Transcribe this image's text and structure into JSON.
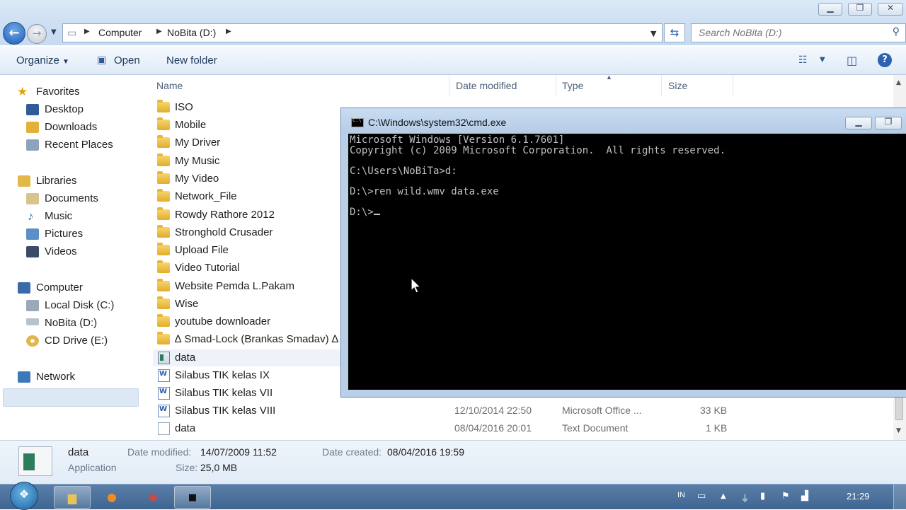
{
  "explorer": {
    "breadcrumb": [
      "Computer",
      "NoBita (D:)"
    ],
    "search_placeholder": "Search NoBita (D:)",
    "toolbar": {
      "organize": "Organize",
      "open": "Open",
      "new_folder": "New folder"
    }
  },
  "nav": {
    "favorites": "Favorites",
    "desktop": "Desktop",
    "downloads": "Downloads",
    "recent_places": "Recent Places",
    "libraries": "Libraries",
    "documents": "Documents",
    "music": "Music",
    "pictures": "Pictures",
    "videos": "Videos",
    "computer": "Computer",
    "local_disk": "Local Disk (C:)",
    "nobita": "NoBita (D:)",
    "cd_drive": "CD Drive (E:)",
    "network": "Network"
  },
  "columns": {
    "name": "Name",
    "date_modified": "Date modified",
    "type": "Type",
    "size": "Size"
  },
  "files": [
    {
      "name": "ISO",
      "kind": "folder"
    },
    {
      "name": "Mobile",
      "kind": "folder"
    },
    {
      "name": "My Driver",
      "kind": "folder"
    },
    {
      "name": "My Music",
      "kind": "folder"
    },
    {
      "name": "My Video",
      "kind": "folder"
    },
    {
      "name": "Network_File",
      "kind": "folder"
    },
    {
      "name": "Rowdy Rathore 2012",
      "kind": "folder"
    },
    {
      "name": "Stronghold Crusader",
      "kind": "folder"
    },
    {
      "name": "Upload File",
      "kind": "folder"
    },
    {
      "name": "Video Tutorial",
      "kind": "folder"
    },
    {
      "name": "Website Pemda L.Pakam",
      "kind": "folder"
    },
    {
      "name": "Wise",
      "kind": "folder"
    },
    {
      "name": "youtube downloader",
      "kind": "folder"
    },
    {
      "name": "∆ Smad-Lock (Brankas Smadav) ∆",
      "kind": "folder"
    },
    {
      "name": "data",
      "kind": "app"
    },
    {
      "name": "Silabus TIK kelas IX",
      "kind": "word"
    },
    {
      "name": "Silabus TIK kelas VII",
      "kind": "word"
    },
    {
      "name": "Silabus TIK kelas VIII",
      "kind": "word",
      "date": "12/10/2014 22:50",
      "type": "Microsoft Office ...",
      "size": "33 KB"
    },
    {
      "name": "data",
      "kind": "txt",
      "date": "08/04/2016 20:01",
      "type": "Text Document",
      "size": "1 KB"
    }
  ],
  "details": {
    "name": "data",
    "kind": "Application",
    "date_modified_label": "Date modified:",
    "date_modified": "14/07/2009 11:52",
    "size_label": "Size:",
    "size": "25,0 MB",
    "date_created_label": "Date created:",
    "date_created": "08/04/2016 19:59"
  },
  "cmd": {
    "title": "C:\\Windows\\system32\\cmd.exe",
    "lines": [
      "Microsoft Windows [Version 6.1.7601]",
      "Copyright (c) 2009 Microsoft Corporation.  All rights reserved.",
      "",
      "C:\\Users\\NoBiTa>d:",
      "",
      "D:\\>ren wild.wmv data.exe",
      "",
      "D:\\>"
    ]
  },
  "taskbar": {
    "lang": "IN",
    "clock": "21:29"
  },
  "colors": {
    "accent": "#3e6591",
    "console_bg": "#000000",
    "console_fg": "#c0c0c0"
  }
}
